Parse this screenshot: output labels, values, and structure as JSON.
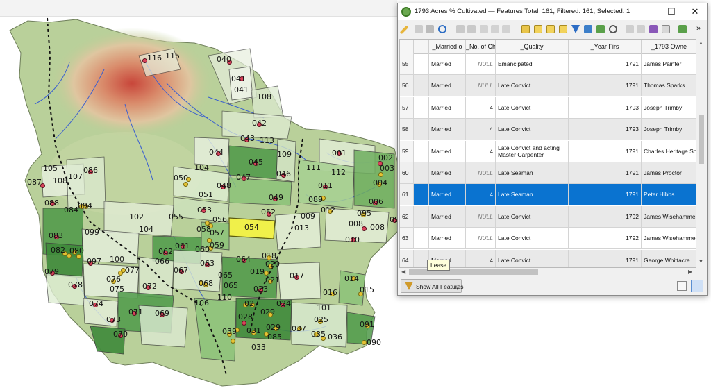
{
  "map": {
    "parcels": [
      {
        "id": "116"
      },
      {
        "id": "115"
      },
      {
        "id": "040"
      },
      {
        "id": "041a",
        "label": "041"
      },
      {
        "id": "041b",
        "label": "041"
      },
      {
        "id": "108a",
        "label": "108"
      },
      {
        "id": "042"
      },
      {
        "id": "043"
      },
      {
        "id": "113"
      },
      {
        "id": "044"
      },
      {
        "id": "045"
      },
      {
        "id": "109"
      },
      {
        "id": "046"
      },
      {
        "id": "104a",
        "label": "104"
      },
      {
        "id": "047"
      },
      {
        "id": "050"
      },
      {
        "id": "048"
      },
      {
        "id": "051"
      },
      {
        "id": "049"
      },
      {
        "id": "053"
      },
      {
        "id": "056"
      },
      {
        "id": "052"
      },
      {
        "id": "055"
      },
      {
        "id": "054"
      },
      {
        "id": "013"
      },
      {
        "id": "009"
      },
      {
        "id": "057"
      },
      {
        "id": "058"
      },
      {
        "id": "059"
      },
      {
        "id": "060"
      },
      {
        "id": "061"
      },
      {
        "id": "062"
      },
      {
        "id": "066"
      },
      {
        "id": "063"
      },
      {
        "id": "064"
      },
      {
        "id": "018"
      },
      {
        "id": "020"
      },
      {
        "id": "019"
      },
      {
        "id": "021"
      },
      {
        "id": "017"
      },
      {
        "id": "067"
      },
      {
        "id": "065a",
        "label": "065"
      },
      {
        "id": "065b",
        "label": "065"
      },
      {
        "id": "068"
      },
      {
        "id": "023"
      },
      {
        "id": "110"
      },
      {
        "id": "106"
      },
      {
        "id": "027"
      },
      {
        "id": "024"
      },
      {
        "id": "029a",
        "label": "029"
      },
      {
        "id": "028"
      },
      {
        "id": "029b",
        "label": "029"
      },
      {
        "id": "037"
      },
      {
        "id": "025"
      },
      {
        "id": "101"
      },
      {
        "id": "016"
      },
      {
        "id": "014"
      },
      {
        "id": "015"
      },
      {
        "id": "039"
      },
      {
        "id": "031"
      },
      {
        "id": "085"
      },
      {
        "id": "033"
      },
      {
        "id": "035"
      },
      {
        "id": "036"
      },
      {
        "id": "091"
      },
      {
        "id": "090"
      },
      {
        "id": "001"
      },
      {
        "id": "002"
      },
      {
        "id": "003"
      },
      {
        "id": "111"
      },
      {
        "id": "112"
      },
      {
        "id": "004"
      },
      {
        "id": "011"
      },
      {
        "id": "006"
      },
      {
        "id": "089"
      },
      {
        "id": "012"
      },
      {
        "id": "095"
      },
      {
        "id": "008a",
        "label": "008"
      },
      {
        "id": "008b",
        "label": "008"
      },
      {
        "id": "099a",
        "label": "09"
      },
      {
        "id": "010"
      },
      {
        "id": "105"
      },
      {
        "id": "086"
      },
      {
        "id": "087"
      },
      {
        "id": "108b",
        "label": "108"
      },
      {
        "id": "107"
      },
      {
        "id": "088"
      },
      {
        "id": "084"
      },
      {
        "id": "094"
      },
      {
        "id": "102"
      },
      {
        "id": "104b",
        "label": "104"
      },
      {
        "id": "099b",
        "label": "099"
      },
      {
        "id": "083"
      },
      {
        "id": "082"
      },
      {
        "id": "080"
      },
      {
        "id": "097"
      },
      {
        "id": "100"
      },
      {
        "id": "077"
      },
      {
        "id": "076"
      },
      {
        "id": "075"
      },
      {
        "id": "079"
      },
      {
        "id": "078"
      },
      {
        "id": "072"
      },
      {
        "id": "074"
      },
      {
        "id": "071"
      },
      {
        "id": "069"
      },
      {
        "id": "073"
      },
      {
        "id": "070"
      }
    ],
    "legend_colors": {
      "improved": "#3f8a3a",
      "partial": "#8cc279",
      "unimproved": "#d8ead0",
      "selected": "#f0f04a"
    }
  },
  "window": {
    "title": "1793 Acres % Cultivated — Features Total: 161, Filtered: 161, Selected: 1",
    "minimize": "—",
    "maximize": "☐",
    "close": "✕",
    "more_tools": "»"
  },
  "table": {
    "columns": [
      "_Married o",
      "_No. of Ch",
      "_Quality",
      "_Year Firs",
      "_1793 Owne"
    ],
    "rows": [
      {
        "n": "55",
        "married": "Married",
        "children": "NULL",
        "quality": "Emancipated",
        "year": "1791",
        "owner": "James Painter"
      },
      {
        "n": "56",
        "married": "Married",
        "children": "NULL",
        "quality": "Late Convict",
        "year": "1791",
        "owner": "Thomas Sparks"
      },
      {
        "n": "57",
        "married": "Married",
        "children": "4",
        "quality": "Late Convict",
        "year": "1793",
        "owner": "Joseph Trimby"
      },
      {
        "n": "58",
        "married": "Married",
        "children": "4",
        "quality": "Late Convict",
        "year": "1793",
        "owner": "Joseph Trimby"
      },
      {
        "n": "59",
        "married": "Married",
        "children": "4",
        "quality": "Late Convict and acting Master Carpenter",
        "year": "1791",
        "owner": "Charles Heritage Sold"
      },
      {
        "n": "60",
        "married": "Married",
        "children": "NULL",
        "quality": "Late Seaman",
        "year": "1791",
        "owner": "James Proctor"
      },
      {
        "n": "61",
        "married": "Married",
        "children": "4",
        "quality": "Late Seaman",
        "year": "1791",
        "owner": "Peter Hibbs"
      },
      {
        "n": "62",
        "married": "Married",
        "children": "NULL",
        "quality": "Late Convict",
        "year": "1792",
        "owner": "James Wisehammer"
      },
      {
        "n": "63",
        "married": "Married",
        "children": "NULL",
        "quality": "Late Convict",
        "year": "1792",
        "owner": "James Wisehammer"
      },
      {
        "n": "64",
        "married": "Married",
        "children": "4",
        "quality": "Late Convict",
        "year": "1791",
        "owner": "George Whittacre"
      }
    ],
    "selected_row": "61",
    "tooltip": "Lease"
  },
  "bottombar": {
    "filter_label": "Show All Features"
  }
}
